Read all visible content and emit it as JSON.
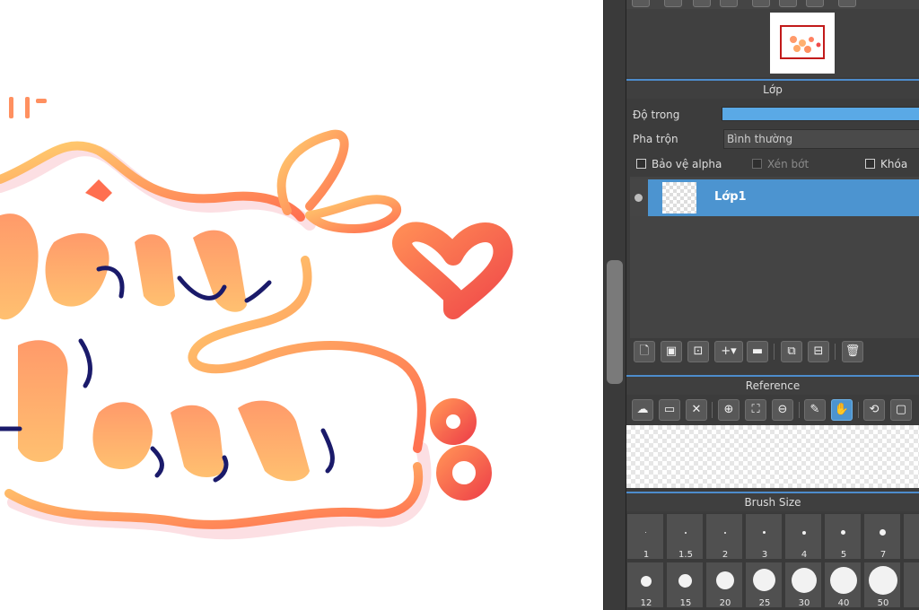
{
  "colors": {
    "accent": "#4c94d0",
    "panel_bg": "#3c3c3c",
    "opacity_bar": "#5aa9e6",
    "heart": "#f0564a"
  },
  "canvas": {
    "artwork_text_top": "ÿêu",
    "artwork_text_bottom": "lam",
    "artwork_number": "8"
  },
  "layer_panel": {
    "title": "Lớp",
    "opacity_label": "Độ trong",
    "opacity_value": 1.0,
    "blend_label": "Pha trộn",
    "blend_value": "Bình thường",
    "protect_alpha_label": "Bảo vệ alpha",
    "clip_label": "Xén bớt",
    "lock_label": "Khóa",
    "layers": [
      {
        "name": "Lớp1",
        "visible": true,
        "selected": true
      }
    ],
    "toolbar_icons": [
      "new-layer-icon",
      "new-raster-layer-icon",
      "new-vector-layer-icon",
      "add-layer-dropdown-icon",
      "folder-icon",
      "duplicate-icon",
      "merge-icon",
      "delete-icon"
    ]
  },
  "reference_panel": {
    "title": "Reference",
    "toolbar_icons": [
      "cloud-icon",
      "open-folder-icon",
      "close-icon",
      "zoom-in-icon",
      "fit-icon",
      "zoom-out-icon",
      "eyedropper-icon",
      "hand-icon",
      "rotate-icon",
      "fullscreen-icon"
    ]
  },
  "brush_size_panel": {
    "title": "Brush Size",
    "sizes": [
      "1",
      "1.5",
      "2",
      "3",
      "4",
      "5",
      "7",
      "",
      "12",
      "15",
      "20",
      "25",
      "30",
      "40",
      "50",
      ""
    ]
  }
}
